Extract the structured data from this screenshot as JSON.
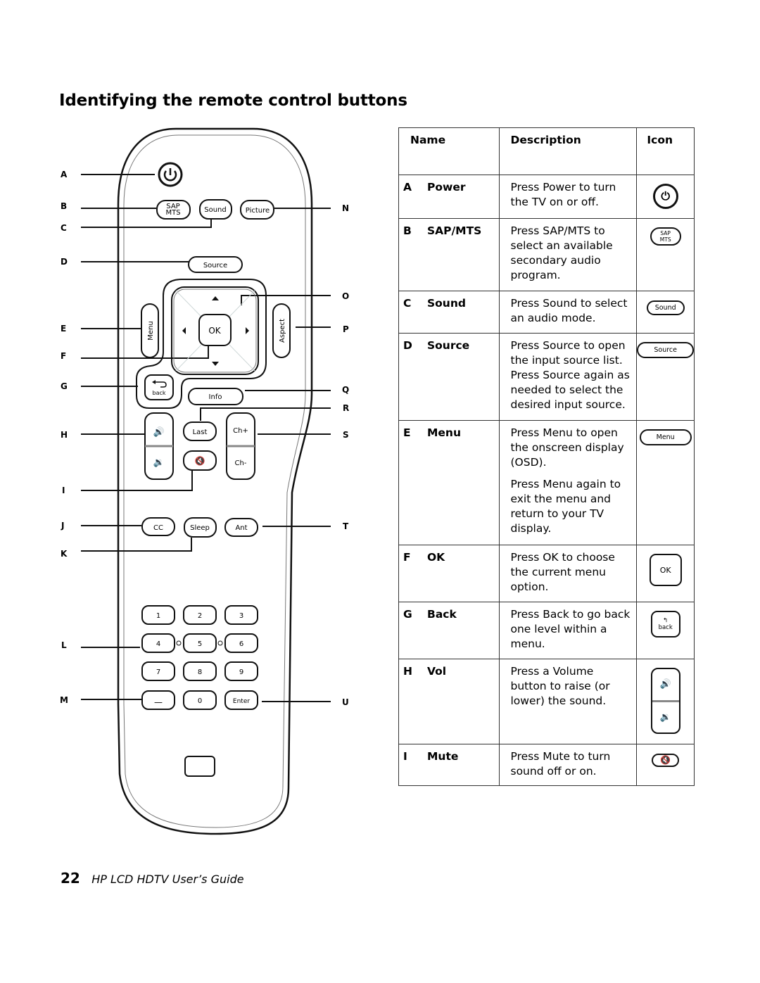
{
  "page": {
    "title": "Identifying the remote control buttons",
    "footer_page_number": "22",
    "footer_guide": "HP LCD HDTV User’s Guide"
  },
  "remote": {
    "callouts_left": [
      "A",
      "B",
      "C",
      "D",
      "E",
      "F",
      "G",
      "H",
      "I",
      "J",
      "K",
      "L",
      "M"
    ],
    "callouts_right": [
      "N",
      "O",
      "P",
      "Q",
      "R",
      "S",
      "T",
      "U"
    ],
    "buttons": {
      "sap_line1": "SAP",
      "sap_line2": "MTS",
      "sound": "Sound",
      "picture": "Picture",
      "source": "Source",
      "menu": "Menu",
      "ok": "OK",
      "aspect": "Aspect",
      "back": "back",
      "info": "Info",
      "last": "Last",
      "ch_up": "Ch+",
      "ch_down": "Ch-",
      "cc": "CC",
      "sleep": "Sleep",
      "ant": "Ant",
      "digits": [
        "1",
        "2",
        "3",
        "4",
        "5",
        "6",
        "7",
        "8",
        "9"
      ],
      "dash": "—",
      "zero": "0",
      "enter": "Enter"
    }
  },
  "table": {
    "headers": {
      "name": "Name",
      "description": "Description",
      "icon": "Icon"
    },
    "rows": [
      {
        "letter": "A",
        "name": "Power",
        "desc": [
          "Press Power to turn the TV on or off."
        ],
        "icon": "power-icon"
      },
      {
        "letter": "B",
        "name": "SAP/MTS",
        "desc": [
          "Press SAP/MTS to select an available secondary audio program."
        ],
        "icon": "sap-mts-icon",
        "icon_line1": "SAP",
        "icon_line2": "MTS"
      },
      {
        "letter": "C",
        "name": "Sound",
        "desc": [
          "Press Sound to select an audio mode."
        ],
        "icon": "sound-button-icon",
        "icon_label": "Sound"
      },
      {
        "letter": "D",
        "name": "Source",
        "desc": [
          "Press Source to open the input source list. Press Source again as needed to select the desired input source."
        ],
        "icon": "source-button-icon",
        "icon_label": "Source"
      },
      {
        "letter": "E",
        "name": "Menu",
        "desc": [
          "Press Menu to open the onscreen display (OSD).",
          "Press Menu again to exit the menu and return to your TV display."
        ],
        "icon": "menu-button-icon",
        "icon_label": "Menu"
      },
      {
        "letter": "F",
        "name": "OK",
        "desc": [
          "Press OK to choose the current menu option."
        ],
        "icon": "ok-button-icon",
        "icon_label": "OK"
      },
      {
        "letter": "G",
        "name": "Back",
        "desc": [
          "Press Back to go back one level within a menu."
        ],
        "icon": "back-icon",
        "icon_label": "back"
      },
      {
        "letter": "H",
        "name": "Vol",
        "desc": [
          "Press a Volume button to raise (or lower) the sound."
        ],
        "icon": "volume-icon"
      },
      {
        "letter": "I",
        "name": "Mute",
        "desc": [
          "Press Mute to turn sound off or on."
        ],
        "icon": "mute-icon"
      }
    ]
  }
}
